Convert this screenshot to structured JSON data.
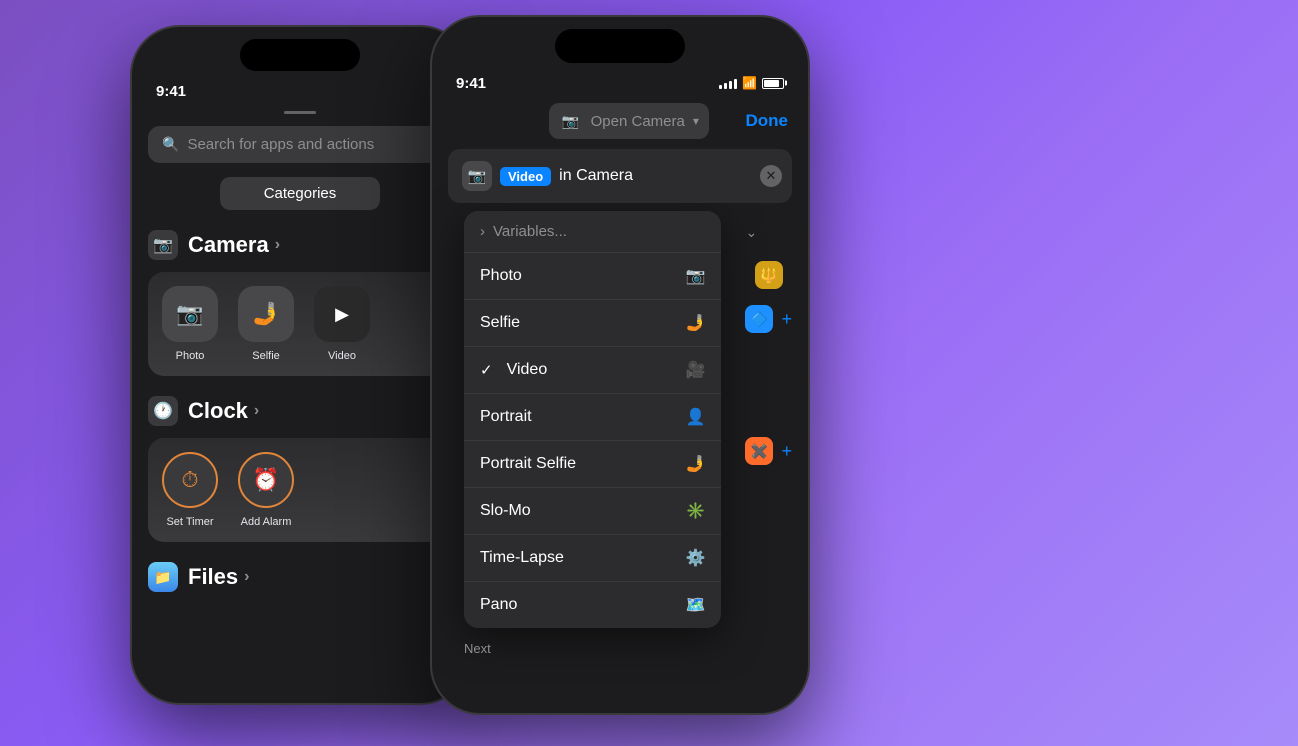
{
  "background": {
    "gradient_start": "#7b4fc0",
    "gradient_end": "#a78bfa"
  },
  "phone1": {
    "time": "9:41",
    "search_placeholder": "Search for apps and actions",
    "categories_btn": "Categories",
    "camera_section": {
      "title": "Camera",
      "actions": [
        {
          "label": "Photo",
          "icon": "📷"
        },
        {
          "label": "Selfie",
          "icon": "🤳"
        },
        {
          "label": "Video",
          "icon": "🎥"
        }
      ]
    },
    "clock_section": {
      "title": "Clock",
      "actions": [
        {
          "label": "Set Timer",
          "icon": "⏱"
        },
        {
          "label": "Add Alarm",
          "icon": "⏰"
        }
      ]
    },
    "files_section": {
      "title": "Files"
    }
  },
  "phone2": {
    "time": "9:41",
    "header_title": "Open Camera",
    "done_btn": "Done",
    "action_block": {
      "tag": "Video",
      "text": "in Camera"
    },
    "dropdown": {
      "header": "Variables...",
      "items": [
        {
          "label": "Photo",
          "icon": "📷",
          "checked": false
        },
        {
          "label": "Selfie",
          "icon": "🤳",
          "checked": false
        },
        {
          "label": "Video",
          "icon": "🎥",
          "checked": true
        },
        {
          "label": "Portrait",
          "icon": "👤",
          "checked": false
        },
        {
          "label": "Portrait Selfie",
          "icon": "🤳",
          "checked": false
        },
        {
          "label": "Slo-Mo",
          "icon": "✳️",
          "checked": false
        },
        {
          "label": "Time-Lapse",
          "icon": "⚙️",
          "checked": false
        },
        {
          "label": "Pano",
          "icon": "🗺️",
          "checked": false
        }
      ]
    },
    "next_label": "Next",
    "panel_items": [
      {
        "icon": "🔱",
        "color": "yellow",
        "has_plus": false,
        "has_chevron": true
      },
      {
        "icon": "🔷",
        "color": "blue",
        "has_plus": true,
        "has_chevron": false
      },
      {
        "icon": "✖️",
        "color": "orange",
        "has_plus": true,
        "has_chevron": false
      }
    ]
  }
}
